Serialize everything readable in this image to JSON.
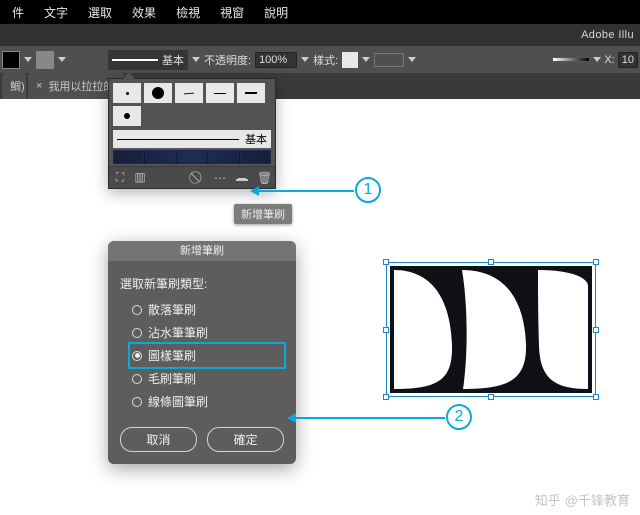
{
  "menubar": {
    "items": [
      "件",
      "文字",
      "選取",
      "效果",
      "檢視",
      "視窗",
      "說明"
    ]
  },
  "appname": "Adobe Illu",
  "optionsbar": {
    "brush_label": "基本",
    "opacity_label": "不透明度:",
    "opacity_value": "100%",
    "style_label": "樣式:",
    "x_label": "X:",
    "x_value": "10"
  },
  "tab": {
    "title": "我用以拉拉的",
    "cutlabel": "鯛)"
  },
  "brush_panel": {
    "row_label": "基本",
    "tooltip": "新增筆刷",
    "footer_icons": [
      "no-icon",
      "lib-icon",
      "cancel-icon",
      "link-icon",
      "new-icon",
      "trash-icon"
    ]
  },
  "dialog": {
    "title": "新增筆刷",
    "prompt": "選取新筆刷類型:",
    "options": [
      {
        "label": "散落筆刷",
        "selected": false,
        "disabled": false
      },
      {
        "label": "沾水筆筆刷",
        "selected": false,
        "disabled": false
      },
      {
        "label": "圖樣筆刷",
        "selected": true,
        "disabled": false
      },
      {
        "label": "毛刷筆刷",
        "selected": false,
        "disabled": false
      },
      {
        "label": "線條圖筆刷",
        "selected": false,
        "disabled": false
      }
    ],
    "cancel": "取消",
    "ok": "確定"
  },
  "callouts": {
    "one": "1",
    "two": "2"
  },
  "watermark": {
    "brand": "知乎",
    "author": "@千锋教育"
  }
}
